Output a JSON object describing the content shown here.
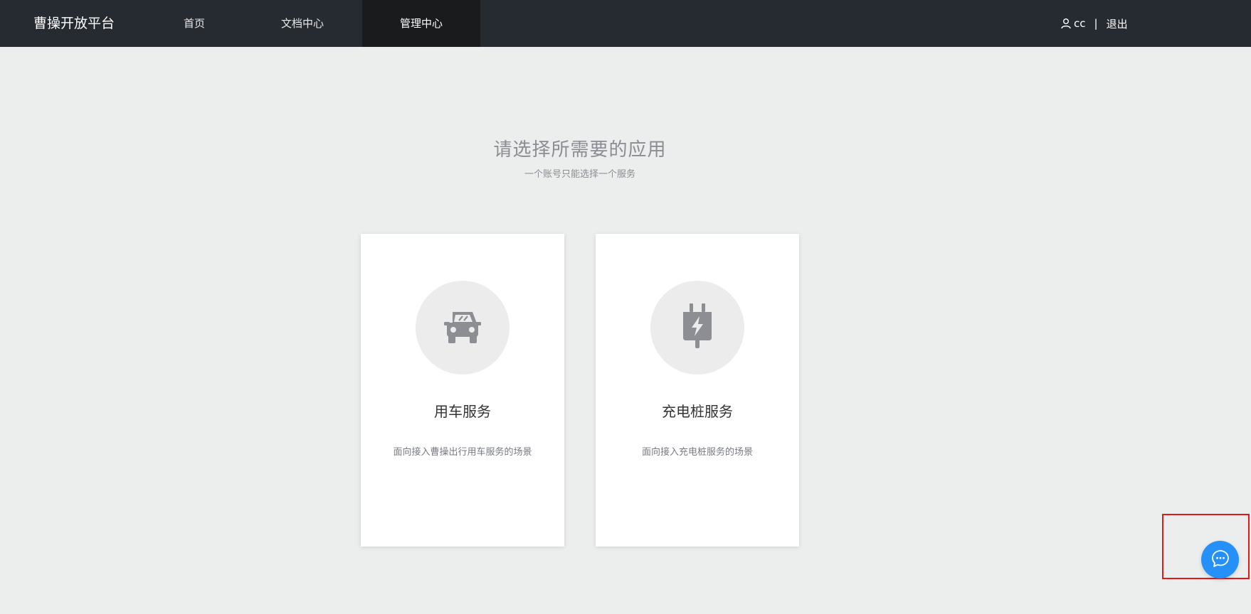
{
  "header": {
    "brand": "曹操开放平台",
    "nav": [
      {
        "label": "首页",
        "active": false
      },
      {
        "label": "文档中心",
        "active": false
      },
      {
        "label": "管理中心",
        "active": true
      }
    ],
    "user": {
      "icon": "user-icon",
      "name": "cc",
      "separator": "|",
      "logout_label": "退出"
    }
  },
  "main": {
    "title": "请选择所需要的应用",
    "subtitle": "一个账号只能选择一个服务",
    "cards": [
      {
        "icon": "car-icon",
        "title": "用车服务",
        "description": "面向接入曹操出行用车服务的场景"
      },
      {
        "icon": "charging-plug-icon",
        "title": "充电桩服务",
        "description": "面向接入充电桩服务的场景"
      }
    ]
  },
  "chat": {
    "icon": "chat-bubble-icon"
  },
  "colors": {
    "topbar": "#262a31",
    "active_nav": "#1a1b1d",
    "page_background": "#eceeed",
    "accent": "#2590f8",
    "highlight_border": "#e31818"
  }
}
